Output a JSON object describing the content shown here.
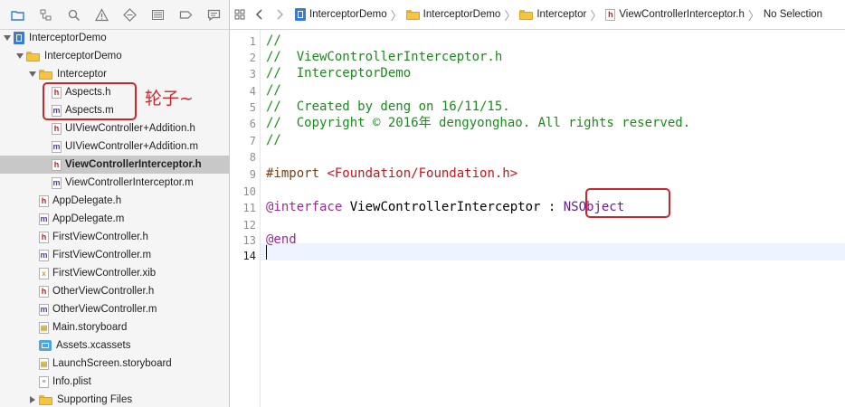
{
  "colors": {
    "annotation_red": "#d0242b",
    "selection_gray": "#c8c8c8",
    "comment_green": "#1d8a1d",
    "keyword_purple": "#a1259e"
  },
  "navigator": {
    "toolbar_icons": [
      "folder-icon",
      "source-control-icon",
      "search-icon",
      "warning-icon",
      "test-icon",
      "debug-icon",
      "breakpoint-icon",
      "report-icon"
    ],
    "annotation": "轮子~",
    "tree": [
      {
        "label": "InterceptorDemo",
        "kind": "project",
        "indent": 0,
        "disclosure": "open"
      },
      {
        "label": "InterceptorDemo",
        "kind": "folder",
        "indent": 1,
        "disclosure": "open"
      },
      {
        "label": "Interceptor",
        "kind": "folder",
        "indent": 2,
        "disclosure": "open"
      },
      {
        "label": "Aspects.h",
        "kind": "h",
        "indent": 3
      },
      {
        "label": "Aspects.m",
        "kind": "m",
        "indent": 3
      },
      {
        "label": "UIViewController+Addition.h",
        "kind": "h",
        "indent": 3
      },
      {
        "label": "UIViewController+Addition.m",
        "kind": "m",
        "indent": 3
      },
      {
        "label": "ViewControllerInterceptor.h",
        "kind": "h",
        "indent": 3,
        "selected": true
      },
      {
        "label": "ViewControllerInterceptor.m",
        "kind": "m",
        "indent": 3
      },
      {
        "label": "AppDelegate.h",
        "kind": "h",
        "indent": 2
      },
      {
        "label": "AppDelegate.m",
        "kind": "m",
        "indent": 2
      },
      {
        "label": "FirstViewController.h",
        "kind": "h",
        "indent": 2
      },
      {
        "label": "FirstViewController.m",
        "kind": "m",
        "indent": 2
      },
      {
        "label": "FirstViewController.xib",
        "kind": "xib",
        "indent": 2
      },
      {
        "label": "OtherViewController.h",
        "kind": "h",
        "indent": 2
      },
      {
        "label": "OtherViewController.m",
        "kind": "m",
        "indent": 2
      },
      {
        "label": "Main.storyboard",
        "kind": "sb",
        "indent": 2
      },
      {
        "label": "Assets.xcassets",
        "kind": "assets",
        "indent": 2
      },
      {
        "label": "LaunchScreen.storyboard",
        "kind": "sb",
        "indent": 2
      },
      {
        "label": "Info.plist",
        "kind": "plist",
        "indent": 2
      },
      {
        "label": "Supporting Files",
        "kind": "folder",
        "indent": 2,
        "disclosure": "closed"
      }
    ]
  },
  "jump_bar": {
    "crumbs": [
      {
        "label": "InterceptorDemo",
        "kind": "project"
      },
      {
        "label": "InterceptorDemo",
        "kind": "folder"
      },
      {
        "label": "Interceptor",
        "kind": "folder"
      },
      {
        "label": "ViewControllerInterceptor.h",
        "kind": "h"
      },
      {
        "label": "No Selection",
        "kind": "none"
      }
    ]
  },
  "editor": {
    "current_line": 14,
    "lines": [
      [
        {
          "t": "//",
          "c": "comment"
        }
      ],
      [
        {
          "t": "//  ViewControllerInterceptor.h",
          "c": "comment"
        }
      ],
      [
        {
          "t": "//  InterceptorDemo",
          "c": "comment"
        }
      ],
      [
        {
          "t": "//",
          "c": "comment"
        }
      ],
      [
        {
          "t": "//  Created by deng on 16/11/15.",
          "c": "comment"
        }
      ],
      [
        {
          "t": "//  Copyright © 2016年 dengyonghao. All rights reserved.",
          "c": "comment"
        }
      ],
      [
        {
          "t": "//",
          "c": "comment"
        }
      ],
      [],
      [
        {
          "t": "#import ",
          "c": "preproc"
        },
        {
          "t": "<Foundation/Foundation.h>",
          "c": "string"
        }
      ],
      [],
      [
        {
          "t": "@interface",
          "c": "keyword"
        },
        {
          "t": " ViewControllerInterceptor : ",
          "c": "plain"
        },
        {
          "t": "NSObject",
          "c": "type"
        }
      ],
      [],
      [
        {
          "t": "@end",
          "c": "keyword"
        }
      ],
      []
    ]
  }
}
